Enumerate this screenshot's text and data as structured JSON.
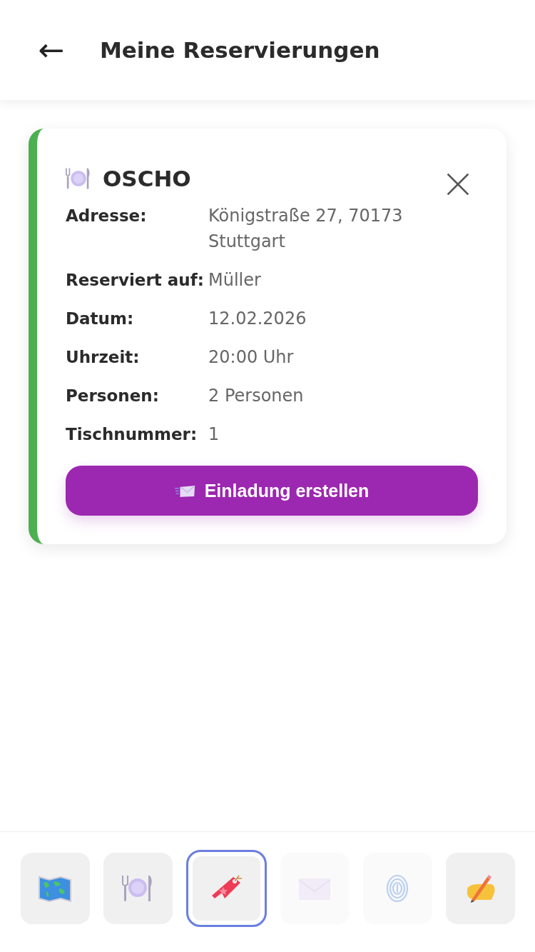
{
  "header": {
    "back": "←",
    "title": "Meine Reservierungen"
  },
  "reservation": {
    "name": "OSCHO",
    "fields": [
      {
        "label": "Adresse:",
        "value": "Königstraße 27, 70173 Stuttgart"
      },
      {
        "label": "Reserviert auf:",
        "value": "Müller"
      },
      {
        "label": "Datum:",
        "value": "12.02.2026"
      },
      {
        "label": "Uhrzeit:",
        "value": "20:00 Uhr"
      },
      {
        "label": "Personen:",
        "value": "2 Personen"
      },
      {
        "label": "Tischnummer:",
        "value": "1"
      }
    ],
    "button": "Einladung erstellen"
  },
  "nav": [
    {
      "kind": "map",
      "selected": false,
      "disabled": false
    },
    {
      "kind": "dining",
      "selected": false,
      "disabled": false
    },
    {
      "kind": "ticket",
      "selected": true,
      "disabled": false
    },
    {
      "kind": "mail",
      "selected": false,
      "disabled": true
    },
    {
      "kind": "fingerprint",
      "selected": false,
      "disabled": true
    },
    {
      "kind": "writing",
      "selected": false,
      "disabled": false
    }
  ]
}
